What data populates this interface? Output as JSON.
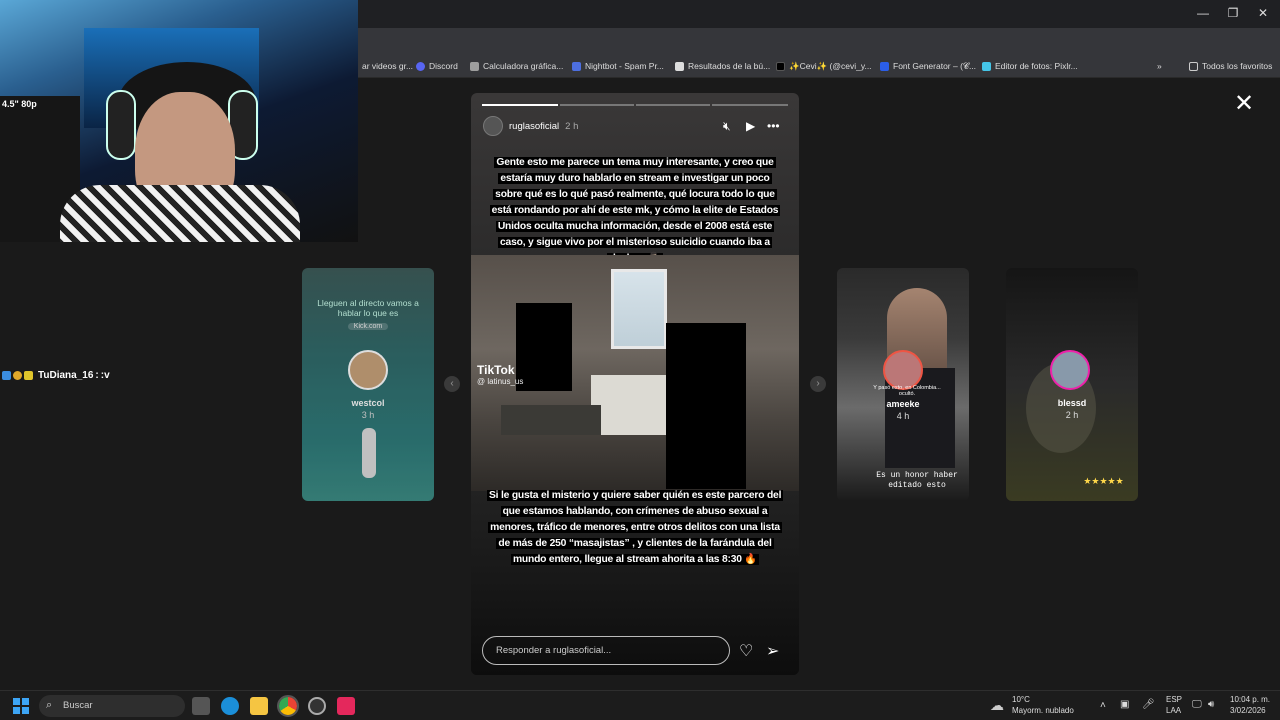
{
  "browser": {
    "bookmarks": [
      {
        "label": "ar videos gr...",
        "icon": "bookmark-icon",
        "color": "#5f6368"
      },
      {
        "label": "Discord",
        "icon": "discord-icon",
        "color": "#5865f2"
      },
      {
        "label": "Calculadora gráfica...",
        "icon": "calculator-icon",
        "color": "#9e9e9e"
      },
      {
        "label": "Nightbot - Spam Pr...",
        "icon": "nightbot-icon",
        "color": "#4d6fe0"
      },
      {
        "label": "Resultados de la bú...",
        "icon": "search-result-icon",
        "color": "#dddddd"
      },
      {
        "label": "✨Cevi✨ (@cevi_y...",
        "icon": "tiktok-icon",
        "color": "#000000"
      },
      {
        "label": "Font Generator – (𝓒...",
        "icon": "font-generator-icon",
        "color": "#2b5ee8"
      },
      {
        "label": "Editor de fotos: Pixlr...",
        "icon": "pixlr-icon",
        "color": "#45c6e8"
      }
    ],
    "all_bookmarks_label": "Todos los favoritos"
  },
  "chat": {
    "username": "TuDiana_16",
    "message": ":v",
    "badge_colors": [
      "#3b8de0",
      "#e0a82b",
      "#e0c52b"
    ]
  },
  "side_stories_left": [
    {
      "name": "westcol",
      "time": "3 h",
      "overlay_text": "Lleguen al directo vamos a hablar lo que es",
      "watermark": "Kick.com"
    }
  ],
  "side_stories_right": [
    {
      "name": "ameeke",
      "time": "4 h",
      "caption": "Es un honor haber editado esto",
      "sticker_text": "Y pasó esto, en Colombia... ocultó."
    },
    {
      "name": "blessd",
      "time": "2 h",
      "stars": "★★★★★"
    }
  ],
  "story": {
    "username": "ruglasoficial",
    "time": "2 h",
    "caption_top": "Gente esto me parece un tema muy interesante, y creo que estaría muy duro hablarlo en stream e investigar un poco sobre qué es lo qué pasó realmente, qué locura todo lo que está rondando por ahí de este mk, y cómo la elite de Estados Unidos oculta mucha información, desde el 2008 está este caso, y sigue vivo por el misterioso suicidio cuando iba a declarar🤷🏻‍♂️",
    "caption_bottom": "Si le gusta el misterio y quiere saber quién es este parcero del que estamos hablando, con crímenes de abuso sexual a menores, tráfico de menores, entre otros delitos con una lista de más de 250 “masajistas” , y clientes de la farándula del mundo entero, llegue al stream ahorita a las 8:30 🔥",
    "tiktok_label": "TikTok",
    "tiktok_handle": "@ latinus_us",
    "reply_placeholder": "Responder a ruglasoficial..."
  },
  "taskbar": {
    "search_placeholder": "Buscar",
    "weather_temp": "10°C",
    "weather_desc": "Mayorm. nublado",
    "lang_1": "ESP",
    "lang_2": "LAA",
    "time": "10:04 p. m.",
    "date": "3/02/2026"
  },
  "webcam": {
    "screen_text": "4.5\" 80p"
  }
}
